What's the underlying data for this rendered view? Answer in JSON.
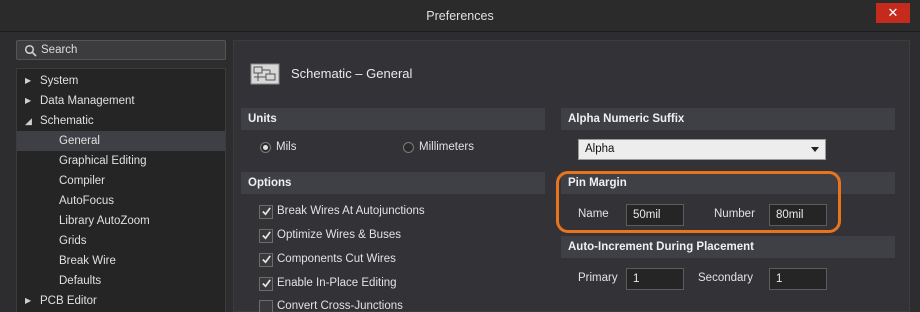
{
  "window": {
    "title": "Preferences",
    "close_glyph": "✕"
  },
  "sidebar": {
    "search_placeholder": "Search",
    "items": [
      {
        "label": "System",
        "expanded": false
      },
      {
        "label": "Data Management",
        "expanded": false
      },
      {
        "label": "Schematic",
        "expanded": true
      },
      {
        "label": "General",
        "selected": true
      },
      {
        "label": "Graphical Editing"
      },
      {
        "label": "Compiler"
      },
      {
        "label": "AutoFocus"
      },
      {
        "label": "Library AutoZoom"
      },
      {
        "label": "Grids"
      },
      {
        "label": "Break Wire"
      },
      {
        "label": "Defaults"
      },
      {
        "label": "PCB Editor",
        "expanded": false
      }
    ]
  },
  "page": {
    "title": "Schematic – General",
    "icon": "schematic-page-icon"
  },
  "units": {
    "header": "Units",
    "options": [
      {
        "label": "Mils",
        "selected": true
      },
      {
        "label": "Millimeters",
        "selected": false
      }
    ]
  },
  "options": {
    "header": "Options",
    "items": [
      {
        "label": "Break Wires At Autojunctions",
        "checked": true
      },
      {
        "label": "Optimize Wires & Buses",
        "checked": true
      },
      {
        "label": "Components Cut Wires",
        "checked": true
      },
      {
        "label": "Enable In-Place Editing",
        "checked": true
      },
      {
        "label": "Convert Cross-Junctions",
        "checked": false
      }
    ]
  },
  "alpha_suffix": {
    "header": "Alpha Numeric Suffix",
    "value": "Alpha"
  },
  "pin_margin": {
    "header": "Pin Margin",
    "name_label": "Name",
    "name_value": "50mil",
    "number_label": "Number",
    "number_value": "80mil"
  },
  "auto_increment": {
    "header": "Auto-Increment During Placement",
    "primary_label": "Primary",
    "primary_value": "1",
    "secondary_label": "Secondary",
    "secondary_value": "1"
  },
  "colors": {
    "accent_highlight": "#e8741e",
    "close_button": "#c42b1c",
    "panel_header": "#3f3f46"
  }
}
